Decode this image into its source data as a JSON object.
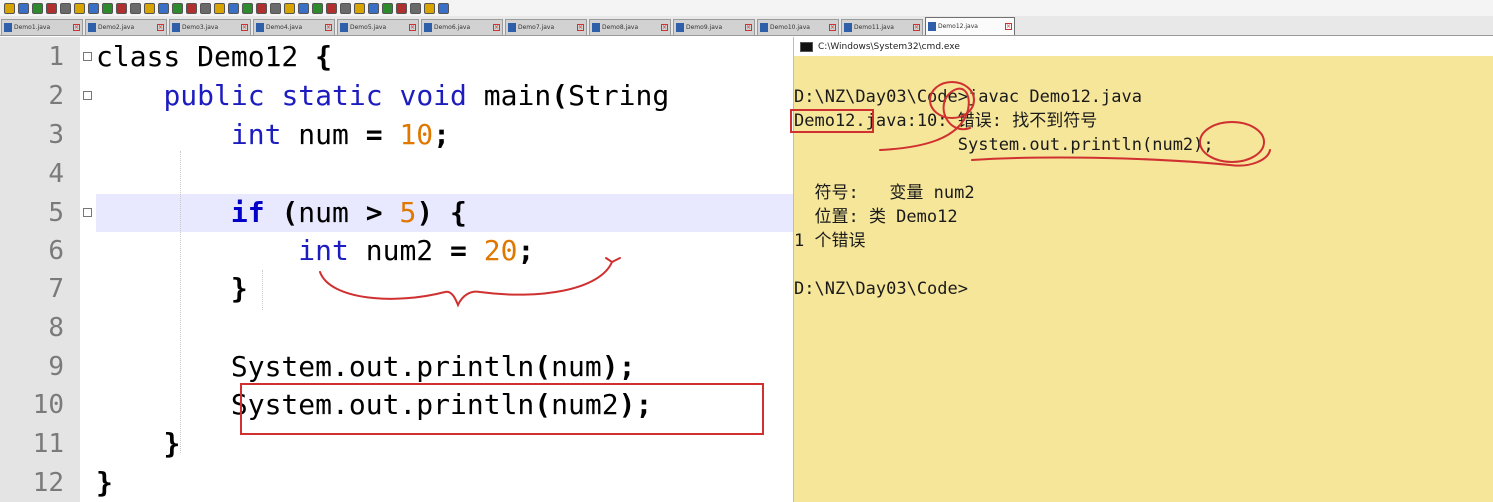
{
  "toolbar": {
    "icons": [
      "new-file-icon",
      "open-file-icon",
      "save-icon",
      "save-all-icon",
      "close-icon",
      "close-all-icon",
      "print-icon",
      "cut-icon",
      "copy-icon",
      "paste-icon",
      "undo-icon",
      "redo-icon",
      "find-icon",
      "replace-icon",
      "zoom-in-icon",
      "zoom-out-icon",
      "sync-vertical-icon",
      "sync-horizontal-icon",
      "word-wrap-icon",
      "show-all-chars-icon",
      "indent-guide-icon",
      "user-language-icon",
      "doc-map-icon",
      "function-list-icon",
      "folder-workspace-icon",
      "monitor-icon",
      "record-macro-icon",
      "stop-macro-icon",
      "play-macro-icon",
      "run-macro-multiple-icon",
      "save-macro-icon",
      "spell-check-icon"
    ]
  },
  "tabs": [
    {
      "label": "Demo1.java"
    },
    {
      "label": "Demo2.java"
    },
    {
      "label": "Demo3.java"
    },
    {
      "label": "Demo4.java"
    },
    {
      "label": "Demo5.java"
    },
    {
      "label": "Demo6.java"
    },
    {
      "label": "Demo7.java"
    },
    {
      "label": "Demo8.java"
    },
    {
      "label": "Demo9.java"
    },
    {
      "label": "Demo10.java"
    },
    {
      "label": "Demo11.java"
    },
    {
      "label": "Demo12.java",
      "active": true
    }
  ],
  "editor": {
    "lines": [
      {
        "n": "1",
        "t": [
          [
            "",
            "class Demo12 "
          ],
          [
            "op",
            "{"
          ]
        ]
      },
      {
        "n": "2",
        "t": [
          [
            "",
            "    "
          ],
          [
            "kw",
            "public"
          ],
          [
            "",
            " "
          ],
          [
            "kw",
            "static"
          ],
          [
            "",
            " "
          ],
          [
            "kw",
            "void"
          ],
          [
            "",
            " main"
          ],
          [
            "op",
            "("
          ],
          [
            "",
            "String"
          ]
        ]
      },
      {
        "n": "3",
        "t": [
          [
            "",
            "        "
          ],
          [
            "kw",
            "int"
          ],
          [
            "",
            " num "
          ],
          [
            "op",
            "="
          ],
          [
            "",
            " "
          ],
          [
            "num",
            "10"
          ],
          [
            "op",
            ";"
          ]
        ]
      },
      {
        "n": "4",
        "t": [
          [
            "",
            ""
          ]
        ]
      },
      {
        "n": "5",
        "t": [
          [
            "",
            "        "
          ],
          [
            "kwb",
            "if"
          ],
          [
            "",
            " "
          ],
          [
            "op",
            "("
          ],
          [
            "",
            "num "
          ],
          [
            "op",
            ">"
          ],
          [
            "",
            " "
          ],
          [
            "num",
            "5"
          ],
          [
            "op",
            ")"
          ],
          [
            "",
            " "
          ],
          [
            "op",
            "{"
          ]
        ]
      },
      {
        "n": "6",
        "t": [
          [
            "",
            "            "
          ],
          [
            "kw",
            "int"
          ],
          [
            "",
            " num2 "
          ],
          [
            "op",
            "="
          ],
          [
            "",
            " "
          ],
          [
            "num",
            "20"
          ],
          [
            "op",
            ";"
          ]
        ]
      },
      {
        "n": "7",
        "t": [
          [
            "",
            "        "
          ],
          [
            "op",
            "}"
          ]
        ]
      },
      {
        "n": "8",
        "t": [
          [
            "",
            ""
          ]
        ]
      },
      {
        "n": "9",
        "t": [
          [
            "",
            "        System.out.println"
          ],
          [
            "op",
            "("
          ],
          [
            "",
            "num"
          ],
          [
            "op",
            ")"
          ],
          [
            "op",
            ";"
          ]
        ]
      },
      {
        "n": "10",
        "t": [
          [
            "",
            "        System.out.println"
          ],
          [
            "op",
            "("
          ],
          [
            "",
            "num2"
          ],
          [
            "op",
            ")"
          ],
          [
            "op",
            ";"
          ]
        ]
      },
      {
        "n": "11",
        "t": [
          [
            "",
            "    "
          ],
          [
            "op",
            "}"
          ]
        ]
      },
      {
        "n": "12",
        "t": [
          [
            "op",
            "}"
          ]
        ]
      }
    ]
  },
  "cmd": {
    "title": "C:\\Windows\\System32\\cmd.exe",
    "lines": [
      "D:\\NZ\\Day03\\Code>javac Demo12.java",
      "Demo12.java:10: 错误: 找不到符号",
      "                System.out.println(num2);",
      "",
      "  符号:   变量 num2",
      "  位置: 类 Demo12",
      "1 个错误",
      "",
      "D:\\NZ\\Day03\\Code>"
    ]
  },
  "colors": {
    "keyword": "#1d1dbf",
    "number": "#e07800",
    "highlight_line": "#e8e8ff",
    "cmd_background": "#f5e69a",
    "annotation": "#d03030"
  }
}
